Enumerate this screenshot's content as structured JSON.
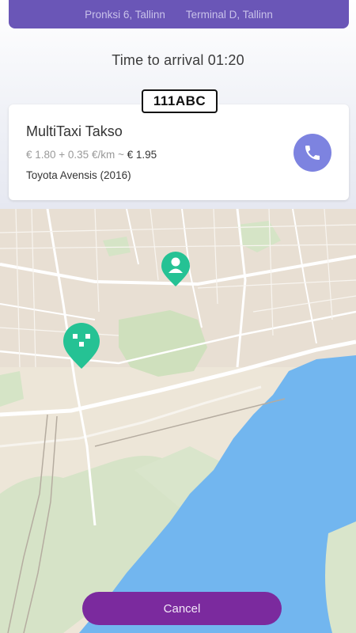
{
  "route": {
    "from": "Pronksi 6, Tallinn",
    "to": "Terminal D, Tallinn"
  },
  "eta": "Time to arrival 01:20",
  "ride": {
    "plate": "111ABC",
    "company": "MultiTaxi Takso",
    "price_formula": "€ 1.80 + 0.35 €/km",
    "price_sep": " ~ ",
    "price_total": "€ 1.95",
    "car": "Toyota Avensis (2016)"
  },
  "actions": {
    "cancel_label": "Cancel"
  },
  "colors": {
    "header": "#6a56b7",
    "call_button": "#7d83e0",
    "cancel_button": "#7b2a9e",
    "map_pin": "#25c294",
    "water": "#72b6ef"
  },
  "icons": {
    "call": "phone-icon",
    "user_pin": "user-location-pin-icon",
    "taxi_pin": "taxi-location-pin-icon"
  }
}
